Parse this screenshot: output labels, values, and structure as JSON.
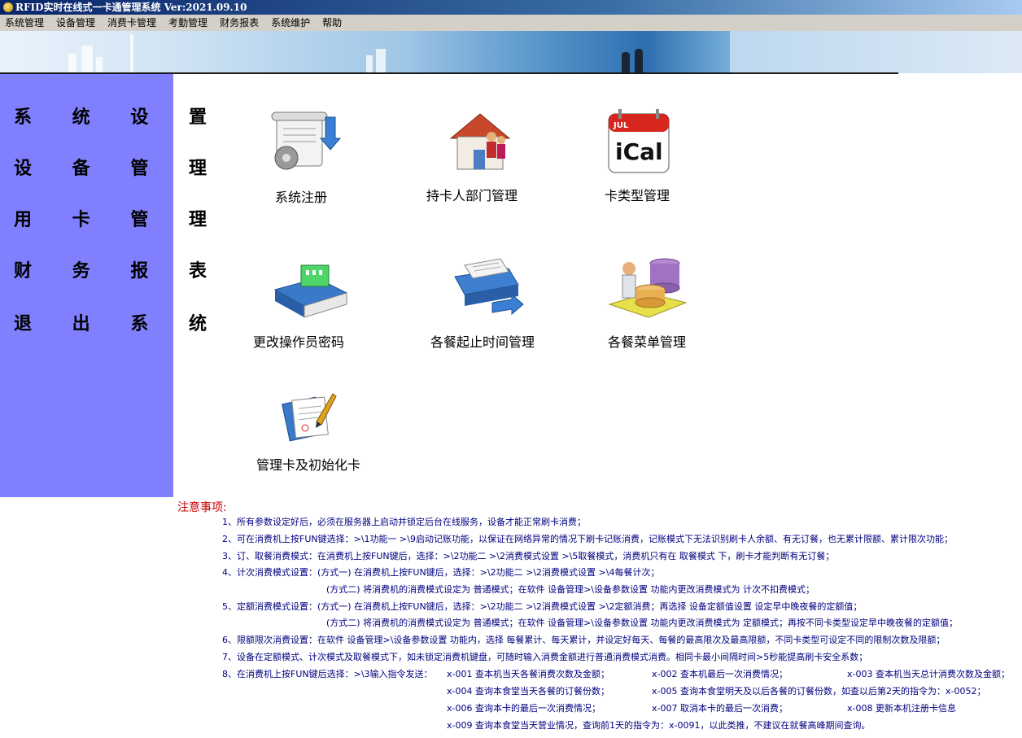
{
  "window": {
    "title": "RFID实时在线式一卡通管理系统 Ver:2021.09.10"
  },
  "menu": [
    "系统管理",
    "设备管理",
    "消费卡管理",
    "考勤管理",
    "财务报表",
    "系统维护",
    "帮助"
  ],
  "sidebar": [
    "系 统 设 置",
    "设 备 管 理",
    "用 卡 管 理",
    "财 务 报 表",
    "退 出 系 统"
  ],
  "tiles": [
    {
      "label": "系统注册",
      "icon": "scroll-gear-icon"
    },
    {
      "label": "持卡人部门管理",
      "icon": "house-people-icon"
    },
    {
      "label": "卡类型管理",
      "icon": "calendar-ical-icon"
    },
    {
      "label": "更改操作员密码",
      "icon": "book-building-icon"
    },
    {
      "label": "各餐起止时间管理",
      "icon": "document-tray-icon"
    },
    {
      "label": "各餐菜单管理",
      "icon": "database-worker-icon"
    },
    {
      "label": "管理卡及初始化卡",
      "icon": "pen-document-icon"
    }
  ],
  "icon_text": {
    "calendar_month": "JUL",
    "calendar_brand": "iCal"
  },
  "notes": {
    "title": "注意事项:",
    "lines": [
      "1、所有参数设定好后，必须在服务器上启动并锁定后台在线服务，设备才能正常刷卡消费；",
      "2、可在消费机上按FUN键选择：>\\1功能一 >\\9启动记账功能，以保证在网络异常的情况下刷卡记账消费，记账模式下无法识别刷卡人余额、有无订餐，也无累计限额、累计限次功能；",
      "3、订、取餐消费模式：在消费机上按FUN键后，选择：>\\2功能二 >\\2消费模式设置 >\\5取餐模式，消费机只有在 取餐模式 下，刷卡才能判断有无订餐；",
      "4、计次消费模式设置：(方式一) 在消费机上按FUN键后，选择：>\\2功能二 >\\2消费模式设置 >\\4每餐计次；",
      "(方式二) 将消费机的消费模式设定为 普通模式；在软件 设备管理>\\设备参数设置 功能内更改消费模式为 计次不扣费模式；",
      "5、定额消费模式设置：(方式一) 在消费机上按FUN键后，选择：>\\2功能二 >\\2消费模式设置 >\\2定额消费；再选择 设备定额值设置 设定早中晚夜餐的定额值；",
      "(方式二) 将消费机的消费模式设定为 普通模式；在软件 设备管理>\\设备参数设置 功能内更改消费模式为 定额模式；再按不同卡类型设定早中晚夜餐的定额值；",
      "6、限额限次消费设置：在软件 设备管理>\\设备参数设置 功能内，选择 每餐累计、每天累计，并设定好每天、每餐的最高限次及最高限额，不同卡类型可设定不同的限制次数及限额；",
      "7、设备在定额模式、计次模式及取餐模式下，如未锁定消费机键盘，可随时输入消费金额进行普通消费模式消费。相同卡最小间隔时间>5秒能提高刷卡安全系数；",
      "8、在消费机上按FUN键后选择：>\\3输入指令发送：",
      "x-001 查本机当天各餐消费次数及金额；",
      "x-002 查本机最后一次消费情况；",
      "x-003 查本机当天总计消费次数及金额；",
      "x-004 查询本食堂当天各餐的订餐份数；",
      "x-005 查询本食堂明天及以后各餐的订餐份数，如查以后第2天的指令为：x-0052；",
      "x-006 查询本卡的最后一次消费情况；",
      "x-007 取消本卡的最后一次消费；",
      "x-008 更新本机注册卡信息",
      "x-009 查询本食堂当天营业情况，查询前1天的指令为：x-0091，以此类推，不建议在就餐高峰期间查询。"
    ]
  },
  "colors": {
    "sidebar": "#8080ff",
    "notes_text": "#000080",
    "notes_title": "#cc0000",
    "menubar": "#d4d0c8"
  }
}
